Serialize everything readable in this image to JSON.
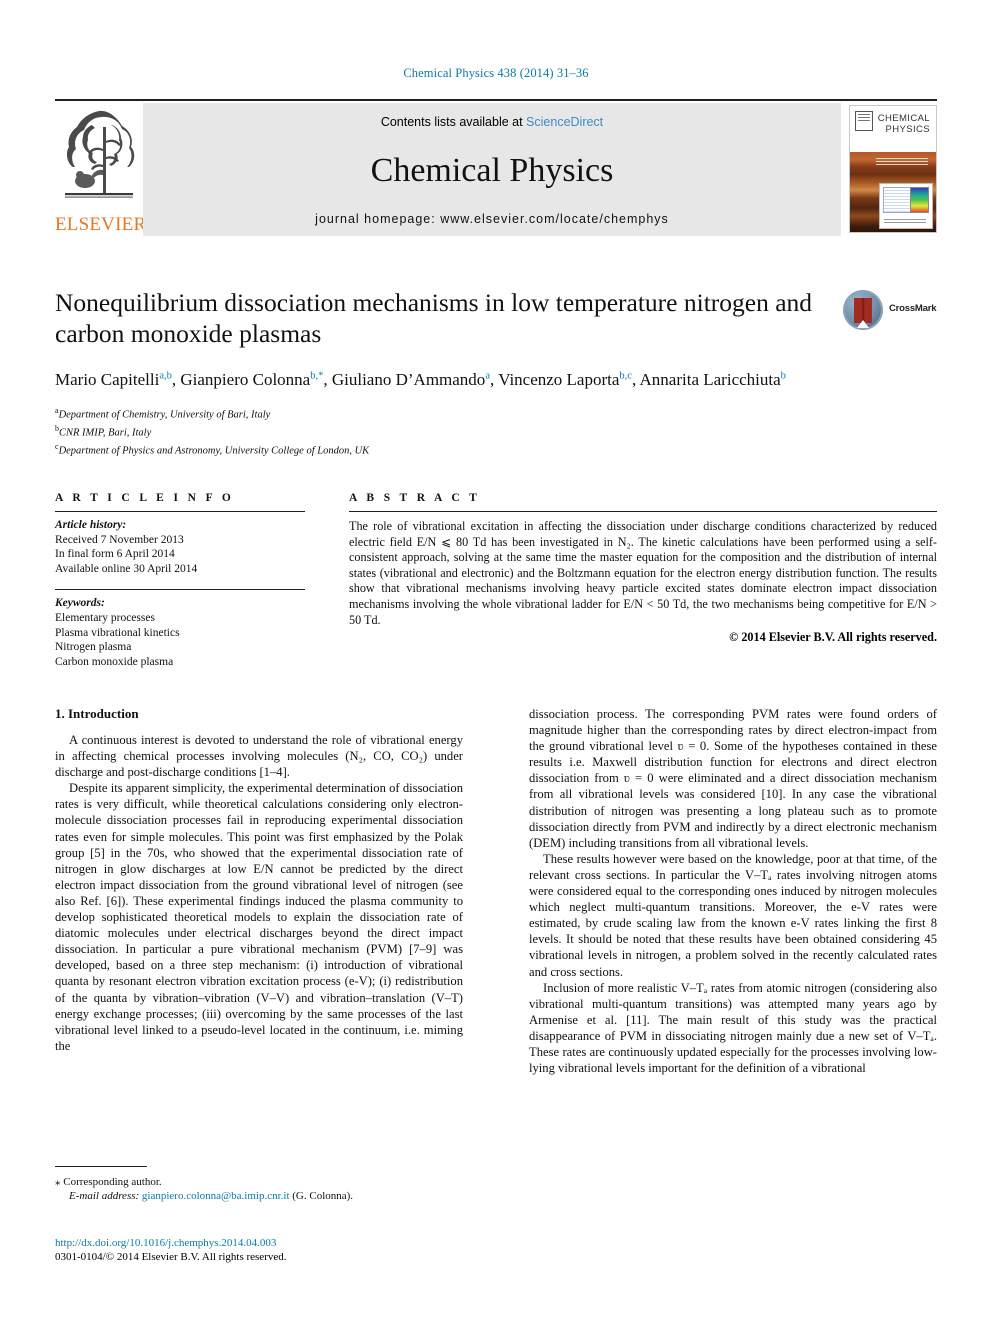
{
  "running_head": "Chemical Physics 438 (2014) 31–36",
  "masthead": {
    "contents_prefix": "Contents lists available at ",
    "sciencedirect": "ScienceDirect",
    "journal_title": "Chemical Physics",
    "homepage": "journal homepage: www.elsevier.com/locate/chemphys",
    "publisher": "ELSEVIER",
    "cover_title_line1": "CHEMICAL",
    "cover_title_line2": "PHYSICS",
    "accent_link_color": "#3d8ec2",
    "elsevier_orange": "#e87722"
  },
  "title": "Nonequilibrium dissociation mechanisms in low temperature nitrogen and carbon monoxide plasmas",
  "crossmark_label": "CrossMark",
  "authors": [
    {
      "name": "Mario Capitelli",
      "sup": "a,b",
      "sep": ", "
    },
    {
      "name": "Gianpiero Colonna",
      "sup": "b,*",
      "sep": ", "
    },
    {
      "name": "Giuliano D’Ammando",
      "sup": "a",
      "sep": ", "
    },
    {
      "name": "Vincenzo Laporta",
      "sup": "b,c",
      "sep": ", "
    },
    {
      "name": "Annarita Laricchiuta",
      "sup": "b",
      "sep": ""
    }
  ],
  "affiliations": [
    {
      "marker": "a",
      "text": "Department of Chemistry, University of Bari, Italy"
    },
    {
      "marker": "b",
      "text": "CNR IMIP, Bari, Italy"
    },
    {
      "marker": "c",
      "text": "Department of Physics and Astronomy, University College of London, UK"
    }
  ],
  "article_info": {
    "label": "A R T I C L E   I N F O",
    "history_header": "Article history:",
    "history": [
      "Received 7 November 2013",
      "In final form 6 April 2014",
      "Available online 30 April 2014"
    ],
    "keywords_header": "Keywords:",
    "keywords": [
      "Elementary processes",
      "Plasma vibrational kinetics",
      "Nitrogen plasma",
      "Carbon monoxide plasma"
    ]
  },
  "abstract": {
    "label": "A B S T R A C T",
    "text": "The role of vibrational excitation in affecting the dissociation under discharge conditions characterized by reduced electric field E/N ⩽ 80 Td has been investigated in N₂. The kinetic calculations have been performed using a self-consistent approach, solving at the same time the master equation for the composition and the distribution of internal states (vibrational and electronic) and the Boltzmann equation for the electron energy distribution function. The results show that vibrational mechanisms involving heavy particle excited states dominate electron impact dissociation mechanisms involving the whole vibrational ladder for E/N < 50 Td, the two mechanisms being competitive for E/N > 50 Td.",
    "copyright": "© 2014 Elsevier B.V. All rights reserved."
  },
  "body": {
    "section_heading": "1. Introduction",
    "left_paragraphs": [
      "A continuous interest is devoted to understand the role of vibrational energy in affecting chemical processes involving molecules (N₂, CO, CO₂) under discharge and post-discharge conditions [1–4].",
      "Despite its apparent simplicity, the experimental determination of dissociation rates is very difficult, while theoretical calculations considering only electron-molecule dissociation processes fail in reproducing experimental dissociation rates even for simple molecules. This point was first emphasized by the Polak group [5] in the 70s, who showed that the experimental dissociation rate of nitrogen in glow discharges at low E/N cannot be predicted by the direct electron impact dissociation from the ground vibrational level of nitrogen (see also Ref. [6]). These experimental findings induced the plasma community to develop sophisticated theoretical models to explain the dissociation rate of diatomic molecules under electrical discharges beyond the direct impact dissociation. In particular a pure vibrational mechanism (PVM) [7–9] was developed, based on a three step mechanism: (i) introduction of vibrational quanta by resonant electron vibration excitation process (e-V); (i) redistribution of the quanta by vibration–vibration (V–V) and vibration–translation (V–T) energy exchange processes; (iii) overcoming by the same processes of the last vibrational level linked to a pseudo-level located in the continuum, i.e. miming the"
    ],
    "right_paragraphs": [
      "dissociation process. The corresponding PVM rates were found orders of magnitude higher than the corresponding rates by direct electron-impact from the ground vibrational level ʋ = 0. Some of the hypotheses contained in these results i.e. Maxwell distribution function for electrons and direct electron dissociation from ʋ = 0 were eliminated and a direct dissociation mechanism from all vibrational levels was considered [10]. In any case the vibrational distribution of nitrogen was presenting a long plateau such as to promote dissociation directly from PVM and indirectly by a direct electronic mechanism (DEM) including transitions from all vibrational levels.",
      "These results however were based on the knowledge, poor at that time, of the relevant cross sections. In particular the V–Tₐ rates involving nitrogen atoms were considered equal to the corresponding ones induced by nitrogen molecules which neglect multi-quantum transitions. Moreover, the e-V rates were estimated, by crude scaling law from the known e-V rates linking the first 8 levels. It should be noted that these results have been obtained considering 45 vibrational levels in nitrogen, a problem solved in the recently calculated rates and cross sections.",
      "Inclusion of more realistic V–Tₐ rates from atomic nitrogen (considering also vibrational multi-quantum transitions) was attempted many years ago by Armenise et al. [11]. The main result of this study was the practical disappearance of PVM in dissociating nitrogen mainly due a new set of V–Tₐ. These rates are continuously updated especially for the processes involving low-lying vibrational levels important for the definition of a vibrational"
    ]
  },
  "footnote": {
    "corresponding_marker": "⁎",
    "corresponding_text": "Corresponding author.",
    "email_label": "E-mail address:",
    "email": "gianpiero.colonna@ba.imip.cnr.it",
    "email_owner": "(G. Colonna)."
  },
  "doi": {
    "url": "http://dx.doi.org/10.1016/j.chemphys.2014.04.003",
    "issn_line": "0301-0104/© 2014 Elsevier B.V. All rights reserved."
  }
}
